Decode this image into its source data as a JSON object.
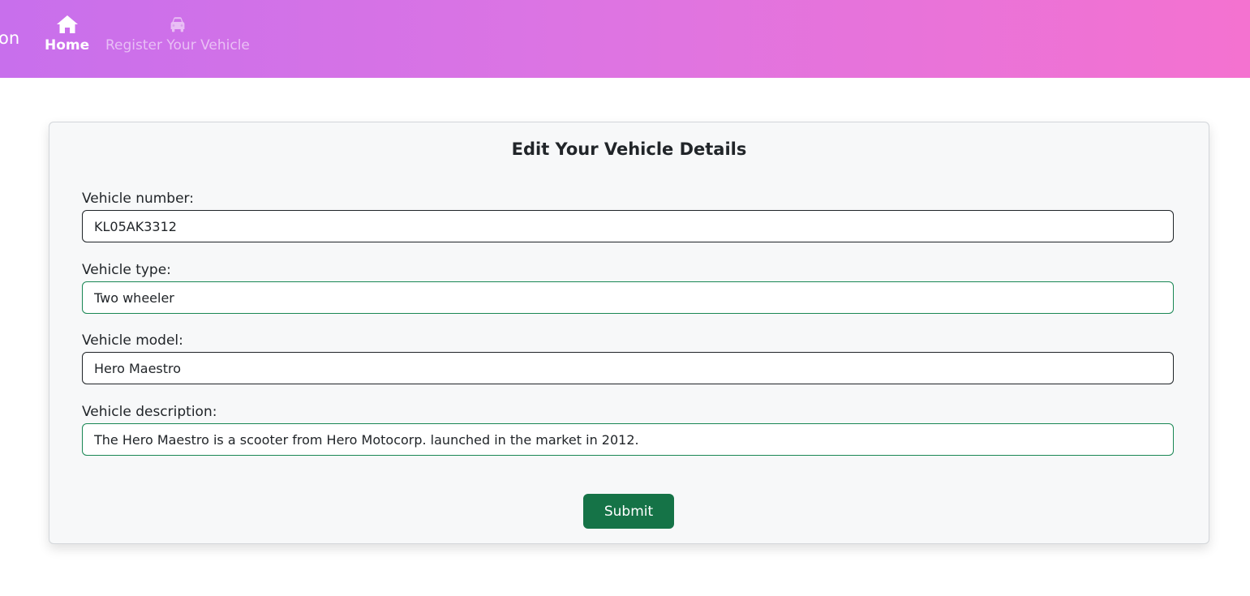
{
  "navbar": {
    "brand_fragment": "on",
    "items": [
      {
        "label": "Home",
        "icon": "home-icon",
        "active": true
      },
      {
        "label": "Register Your Vehicle",
        "icon": "car-icon",
        "active": false
      }
    ],
    "gradient_start": "#c86fec",
    "gradient_end": "#f472d0"
  },
  "form": {
    "title": "Edit Your Vehicle Details",
    "fields": [
      {
        "label": "Vehicle number:",
        "value": "KL05AK3312"
      },
      {
        "label": "Vehicle type:",
        "value": "Two wheeler"
      },
      {
        "label": "Vehicle model:",
        "value": "Hero Maestro"
      },
      {
        "label": "Vehicle description:",
        "value": "The Hero Maestro is a scooter from Hero Motocorp. launched in the market in 2012."
      }
    ],
    "submit_label": "Submit",
    "accent_color": "#157347"
  }
}
